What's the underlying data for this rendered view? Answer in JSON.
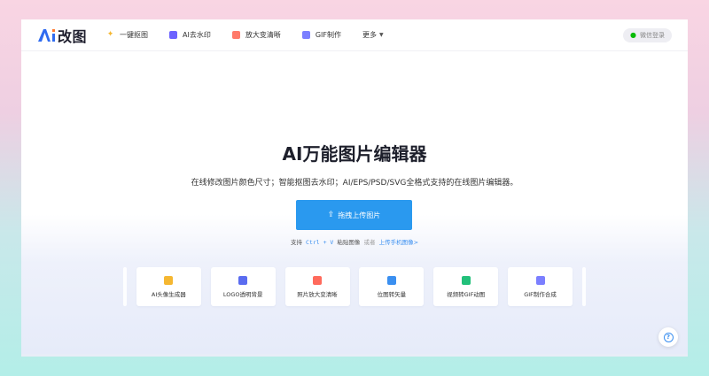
{
  "header": {
    "logo_text": "改图",
    "nav": [
      {
        "label": "一键抠图",
        "icon": "magic-star-icon"
      },
      {
        "label": "AI去水印",
        "icon": "ai-watermark-icon"
      },
      {
        "label": "放大变清晰",
        "icon": "enlarge-icon"
      },
      {
        "label": "GIF制作",
        "icon": "gif-icon"
      }
    ],
    "more_label": "更多",
    "login_label": "微信登录"
  },
  "hero": {
    "title": "AI万能图片编辑器",
    "subtitle": "在线修改图片颜色尺寸；智能抠图去水印；AI/EPS/PSD/SVG全格式支持的在线图片编辑器。",
    "upload_label": "拖拽上传图片",
    "hint_prefix": "支持",
    "hint_key": "Ctrl + V",
    "hint_mid": "粘贴图像",
    "hint_or": "或者",
    "hint_link": "上传手机图像>"
  },
  "tools": [
    {
      "label": "AI头像生成器",
      "icon": "avatar-icon",
      "color": "#f5b731"
    },
    {
      "label": "LOGO透明背景",
      "icon": "transparent-bg-icon",
      "color": "#5a6cf0"
    },
    {
      "label": "照片放大变清晰",
      "icon": "photo-enlarge-icon",
      "color": "#ff6a5c"
    },
    {
      "label": "位图转矢量",
      "icon": "vector-icon",
      "color": "#3a8ff0"
    },
    {
      "label": "视频转GIF动图",
      "icon": "video-gif-icon",
      "color": "#22c07a"
    },
    {
      "label": "GIF制作合成",
      "icon": "gif-make-icon",
      "color": "#7b7fff"
    }
  ],
  "help_label": "?"
}
